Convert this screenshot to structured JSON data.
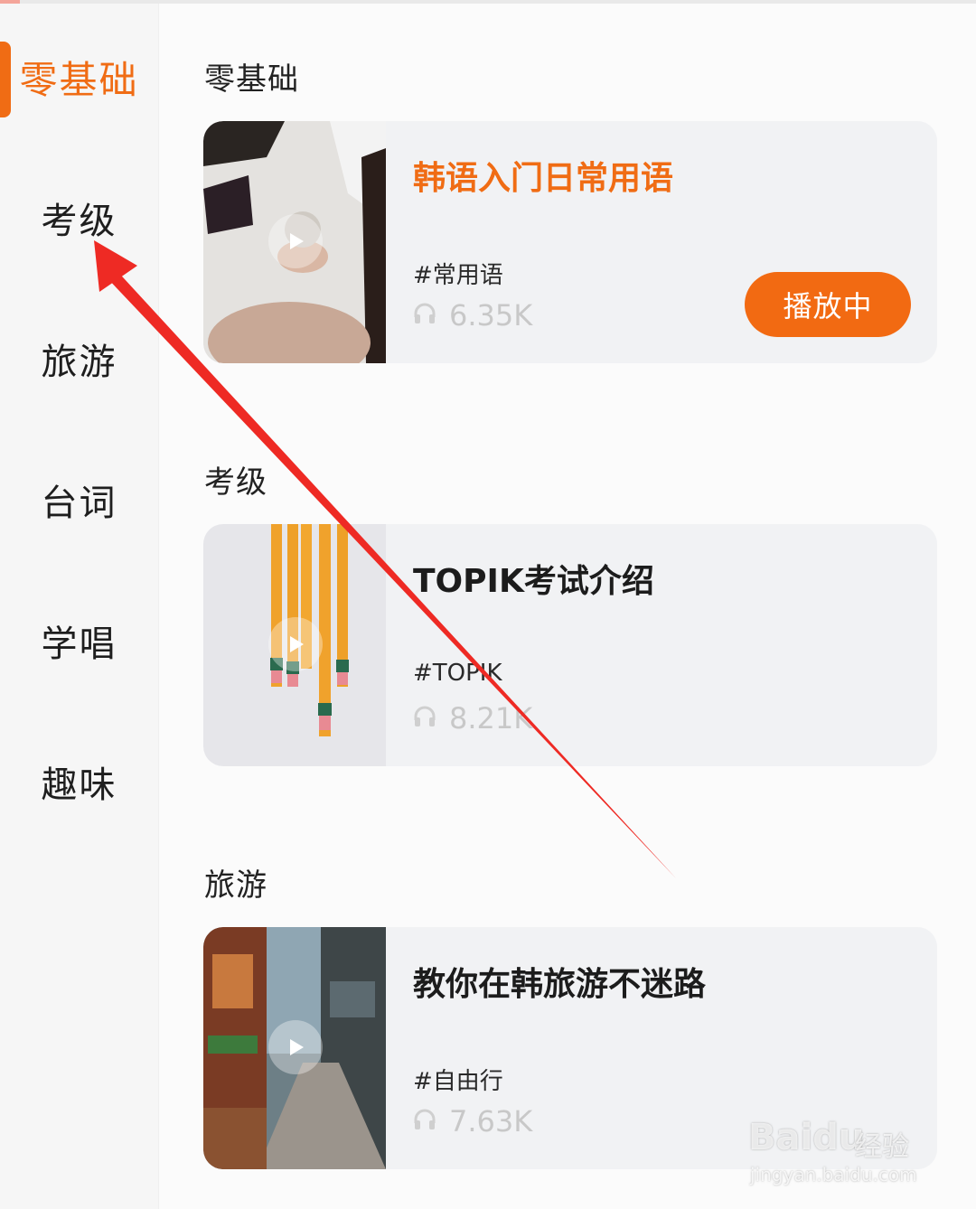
{
  "sidebar": {
    "items": [
      {
        "label": "零基础",
        "active": true
      },
      {
        "label": "考级"
      },
      {
        "label": "旅游"
      },
      {
        "label": "台词"
      },
      {
        "label": "学唱"
      },
      {
        "label": "趣味"
      }
    ]
  },
  "sections": [
    {
      "title": "零基础",
      "card": {
        "title": "韩语入门日常用语",
        "tag": "#常用语",
        "count": "6.35K",
        "status_button": "播放中",
        "playing": true
      }
    },
    {
      "title": "考级",
      "card": {
        "title": "TOPIK考试介绍",
        "tag": "#TOPIK",
        "count": "8.21K"
      }
    },
    {
      "title": "旅游",
      "card": {
        "title": "教你在韩旅游不迷路",
        "tag": "#自由行",
        "count": "7.63K"
      }
    }
  ],
  "icons": {
    "listen": "headphones-icon",
    "play": "play-icon"
  },
  "colors": {
    "accent": "#f06c14",
    "annotation_arrow": "#ee2a24"
  },
  "watermark": {
    "brand": "Baidu",
    "sub": "经验",
    "url": "jingyan.baidu.com"
  }
}
